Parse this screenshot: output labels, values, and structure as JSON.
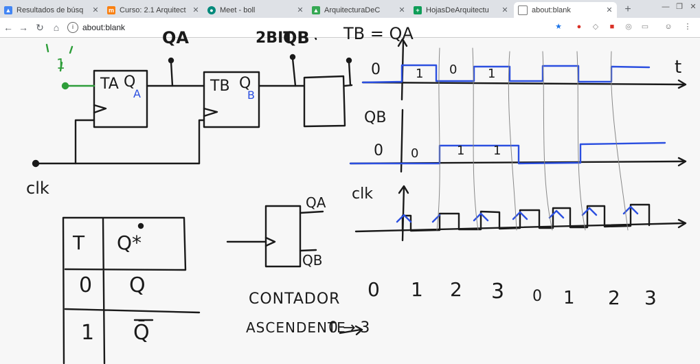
{
  "browser": {
    "tabs": [
      {
        "label": "Resultados de búsq",
        "icon": "google-drive-icon",
        "active": false
      },
      {
        "label": "Curso: 2.1 Arquitect",
        "icon": "moodle-icon",
        "active": false
      },
      {
        "label": "Meet - boll",
        "icon": "meet-icon",
        "active": false
      },
      {
        "label": "ArquitecturaDeC",
        "icon": "google-drive-icon",
        "active": false
      },
      {
        "label": "HojasDeArquitectu",
        "icon": "sheets-icon",
        "active": false
      },
      {
        "label": "about:blank",
        "icon": "page-icon",
        "active": true
      }
    ],
    "url": "about:blank"
  },
  "whiteboard": {
    "title_bit": "2BIT",
    "label_qa": "QA",
    "label_qb": "QB",
    "equation": "TB = QA",
    "clk_label": "clk",
    "ff_a": {
      "t": "TA",
      "q": "Q",
      "sub": "A"
    },
    "ff_b": {
      "t": "TB",
      "q": "Q",
      "sub": "B"
    },
    "input_one": "1",
    "truth_table": {
      "headers": [
        "T",
        "Q*"
      ],
      "rows": [
        [
          "0",
          "Q"
        ],
        [
          "1",
          "Q̄"
        ]
      ]
    },
    "block_out_a": "QA",
    "block_out_b": "QB",
    "timing": {
      "row_qa": {
        "axis": "t",
        "level": "0",
        "bits": [
          "1",
          "0",
          "1"
        ]
      },
      "row_qb": {
        "label": "QB",
        "level": "0",
        "bits": [
          "0",
          "1",
          "1"
        ]
      },
      "row_clk": {
        "label": "clk"
      }
    },
    "counter_label": "CONTADOR",
    "counter_values": [
      "0",
      "1",
      "2",
      "3",
      "0",
      "1",
      "2",
      "3"
    ],
    "ascending_label": "ASCENDENTE",
    "ascending_range": "0 → 3"
  },
  "colors": {
    "ink": "#1a1a1a",
    "blue": "#2b4fe0",
    "green": "#2e9e3a"
  }
}
